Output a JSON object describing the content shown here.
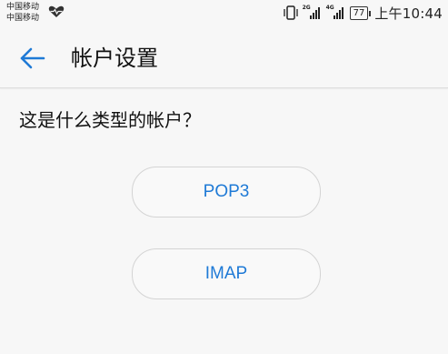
{
  "status_bar": {
    "carriers": [
      "中国移动",
      "中国移动"
    ],
    "sig1_tag": "2G",
    "sig2_tag": "4G",
    "battery": "77",
    "time": "上午10:44"
  },
  "header": {
    "title": "帐户设置",
    "back_icon": "arrow-left-icon"
  },
  "main": {
    "question": "这是什么类型的帐户？",
    "options": [
      {
        "label": "POP3"
      },
      {
        "label": "IMAP"
      }
    ]
  },
  "colors": {
    "accent": "#1f7ad6",
    "background": "#f7f7f7"
  }
}
